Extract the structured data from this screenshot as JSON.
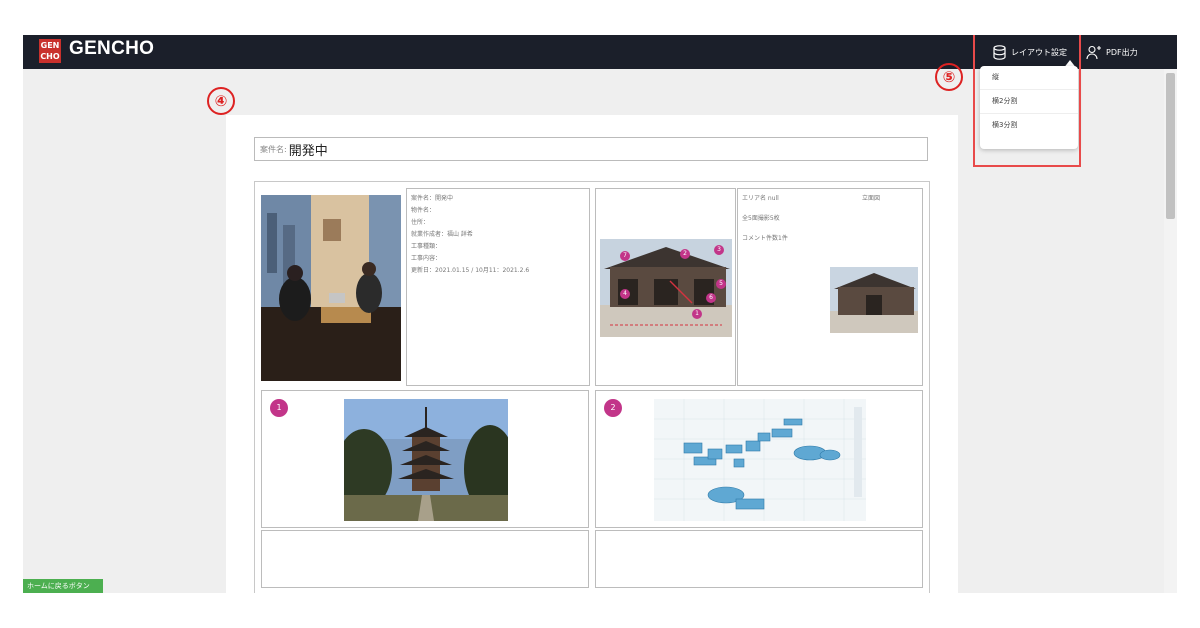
{
  "app": {
    "brand": "GENCHO",
    "logo_line1": "GEN",
    "logo_line2": "CHO"
  },
  "nav": {
    "layout_label": "レイアウト設定",
    "pdf_label": "PDF出力"
  },
  "dropdown": {
    "items": [
      "縦",
      "横2分割",
      "横3分割"
    ]
  },
  "callouts": {
    "main": "④",
    "menu": "⑤"
  },
  "project": {
    "name_prefix": "案件名:",
    "name_value": "開発中"
  },
  "info": {
    "lines": [
      "案件名：開発中",
      "物件名：",
      "住所：",
      "就業作成者：福山 詳希",
      "工事種類：",
      "工事内容：",
      "更新日：2021.01.15 / 10月11：2021.2.6"
    ]
  },
  "area": {
    "left_label": "エリア名 null",
    "right_label": "立面図",
    "line2": "全5面撮影5枚",
    "line3": "コメント件数1件"
  },
  "photos": [
    {
      "badge": "1"
    },
    {
      "badge": "2"
    }
  ],
  "markers": [
    "1",
    "2",
    "3",
    "4",
    "5",
    "6",
    "7"
  ],
  "footer": {
    "green_button": "ホームに戻るボタン"
  },
  "colors": {
    "topbar": "#1b1f2a",
    "accent": "#c23589",
    "callout": "#e84a4a"
  }
}
